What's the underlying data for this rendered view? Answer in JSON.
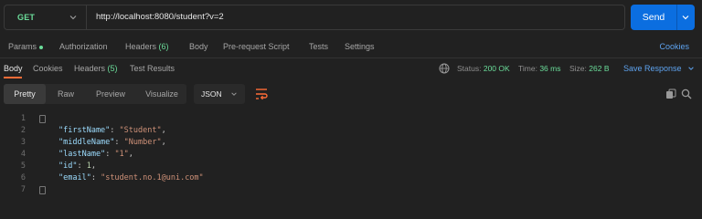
{
  "request": {
    "method": "GET",
    "url": "http://localhost:8080/student?v=2",
    "send_label": "Send"
  },
  "request_tabs": {
    "params": "Params",
    "authorization": "Authorization",
    "headers": "Headers",
    "headers_count": "(6)",
    "body": "Body",
    "pre_request_script": "Pre-request Script",
    "tests": "Tests",
    "settings": "Settings",
    "cookies": "Cookies"
  },
  "response_tabs": {
    "body": "Body",
    "cookies": "Cookies",
    "headers": "Headers",
    "headers_count": "(5)",
    "test_results": "Test Results"
  },
  "response_meta": {
    "status_label": "Status:",
    "status_value": "200 OK",
    "time_label": "Time:",
    "time_value": "36 ms",
    "size_label": "Size:",
    "size_value": "262 B",
    "save_response": "Save Response"
  },
  "view_modes": {
    "pretty": "Pretty",
    "raw": "Raw",
    "preview": "Preview",
    "visualize": "Visualize",
    "format": "JSON"
  },
  "code": {
    "line_numbers": [
      "1",
      "2",
      "3",
      "4",
      "5",
      "6",
      "7"
    ],
    "open_brace": "{",
    "close_brace": "}",
    "entries": [
      {
        "key": "\"firstName\"",
        "value": "\"Student\"",
        "value_type": "string"
      },
      {
        "key": "\"middleName\"",
        "value": "\"Number\"",
        "value_type": "string"
      },
      {
        "key": "\"lastName\"",
        "value": "\"1\"",
        "value_type": "string"
      },
      {
        "key": "\"id\"",
        "value": "1",
        "value_type": "number"
      },
      {
        "key": "\"email\"",
        "value": "\"student.no.1@uni.com\"",
        "value_type": "string"
      }
    ]
  },
  "colors": {
    "accent_send": "#0b6ee0",
    "method_get": "#6bdd9a",
    "status_ok": "#6bdd9a",
    "link_blue": "#5ea3ef",
    "active_tab_underline": "#ff6c37"
  },
  "icons": [
    "chevron-down-icon",
    "globe-icon",
    "wrap-lines-icon",
    "copy-icon",
    "search-icon",
    "fold-icon"
  ]
}
